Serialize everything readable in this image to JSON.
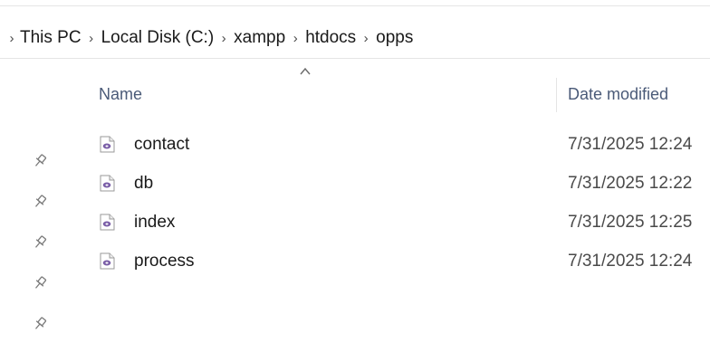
{
  "breadcrumb": {
    "items": [
      "This PC",
      "Local Disk (C:)",
      "xampp",
      "htdocs",
      "opps"
    ]
  },
  "columns": {
    "name": "Name",
    "date_modified": "Date modified"
  },
  "files": [
    {
      "name": "contact",
      "date": "7/31/2025 12:24"
    },
    {
      "name": "db",
      "date": "7/31/2025 12:22"
    },
    {
      "name": "index",
      "date": "7/31/2025 12:25"
    },
    {
      "name": "process",
      "date": "7/31/2025 12:24"
    }
  ],
  "icons": {
    "file": "php-file-icon",
    "pin": "pin-icon",
    "sort": "sort-up-icon"
  },
  "colors": {
    "header_text": "#4a5a78",
    "php_purple": "#7b5fa8"
  }
}
